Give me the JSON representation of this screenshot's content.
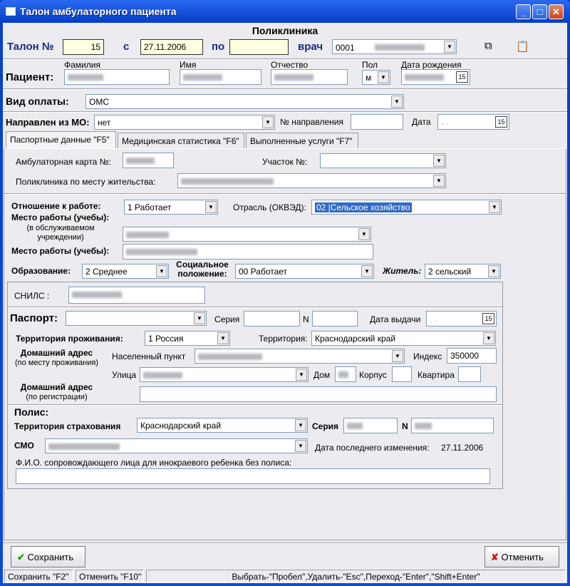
{
  "window": {
    "title": "Талон амбулаторного пациента",
    "section_title": "Поликлиника"
  },
  "header": {
    "talon_label": "Талон №",
    "talon_number": "15",
    "from_label": "с",
    "from_date": "27.11.2006",
    "to_label": "по",
    "to_date": "",
    "doctor_label": "врач",
    "doctor_code": "0001"
  },
  "patient": {
    "label": "Пациент:",
    "surname_label": "Фамилия",
    "name_label": "Имя",
    "patronymic_label": "Отчество",
    "sex_label": "Пол",
    "sex_value": "м",
    "birthdate_label": "Дата рождения"
  },
  "payment": {
    "label": "Вид оплаты:",
    "value": "ОМС"
  },
  "referral": {
    "label": "Направлен из МО:",
    "value": "нет",
    "number_label": "№ направления",
    "number_value": "",
    "date_label": "Дата",
    "date_value": ". ."
  },
  "tabs": [
    {
      "label": "Паспортные данные \"F5\"",
      "active": true
    },
    {
      "label": "Медицинская статистика \"F6\""
    },
    {
      "label": "Выполненные услуги \"F7\""
    }
  ],
  "passport_tab": {
    "card_label": "Амбулаторная карта №:",
    "district_label": "Участок №:",
    "district_value": "",
    "clinic_label": "Поликлиника по месту жительства:",
    "work_relation_label": "Отношение к работе:",
    "work_relation_value": "1 Работает",
    "industry_label": "Отрасль (ОКВЭД):",
    "industry_value": "02 |Сельское хозяйство",
    "workplace_label": "Место работы (учебы):",
    "workplace_served_note": "(в обслуживаемом учреждении)",
    "workplace_label2": "Место работы (учебы):",
    "education_label": "Образование:",
    "education_value": "2  Среднее",
    "social_label": "Социальное положение:",
    "social_value": "00   Работает",
    "resident_label": "Житель:",
    "resident_value": "2  сельский",
    "snils_label": "СНИЛС :",
    "passport_label": "Паспорт:",
    "passport_value": "",
    "series_label": "Серия",
    "series_value": "",
    "n_label": "N",
    "n_value": "",
    "issue_date_label": "Дата выдачи",
    "issue_date_value": ". .",
    "residence_territory_label": "Территория проживания:",
    "residence_territory_value": "1  Россия",
    "territory_label": "Территория:",
    "territory_value": "Краснодарский край",
    "home_address_label": "Домашний адрес",
    "home_address_note": "(по месту проживания)",
    "locality_label": "Населенный пункт",
    "index_label": "Индекс",
    "index_value": "350000",
    "street_label": "Улица",
    "house_label": "Дом",
    "building_label": "Корпус",
    "building_value": "",
    "flat_label": "Квартира",
    "flat_value": "",
    "reg_address_label": "Домашний адрес",
    "reg_address_note": "(по регистрации)",
    "reg_address_value": "",
    "policy_label": "Полис:",
    "insurance_territory_label": "Территория страхования",
    "insurance_territory_value": "Краснодарский край",
    "policy_series_label": "Серия",
    "policy_n_label": "N",
    "smo_label": "СМО",
    "last_change_label": "Дата последнего изменения:",
    "last_change_value": "27.11.2006",
    "companion_label": "Ф.И.О. сопровождающего лица для инокраевого ребенка без полиса:",
    "companion_value": ""
  },
  "buttons": {
    "save": "Сохранить",
    "cancel": "Отменить"
  },
  "statusbar": {
    "save_hint": "Сохранить \"F2\"",
    "cancel_hint": "Отменить \"F10\"",
    "keys_hint": "Выбрать-\"Пробел\",Удалить-\"Esc\",Переход-\"Enter\",\"Shift+Enter\""
  },
  "colors": {
    "titlebar": "#0a3fbf",
    "header_label": "#1a2a80",
    "highlight": "#316ac5",
    "required_field": "#ffffe1"
  }
}
